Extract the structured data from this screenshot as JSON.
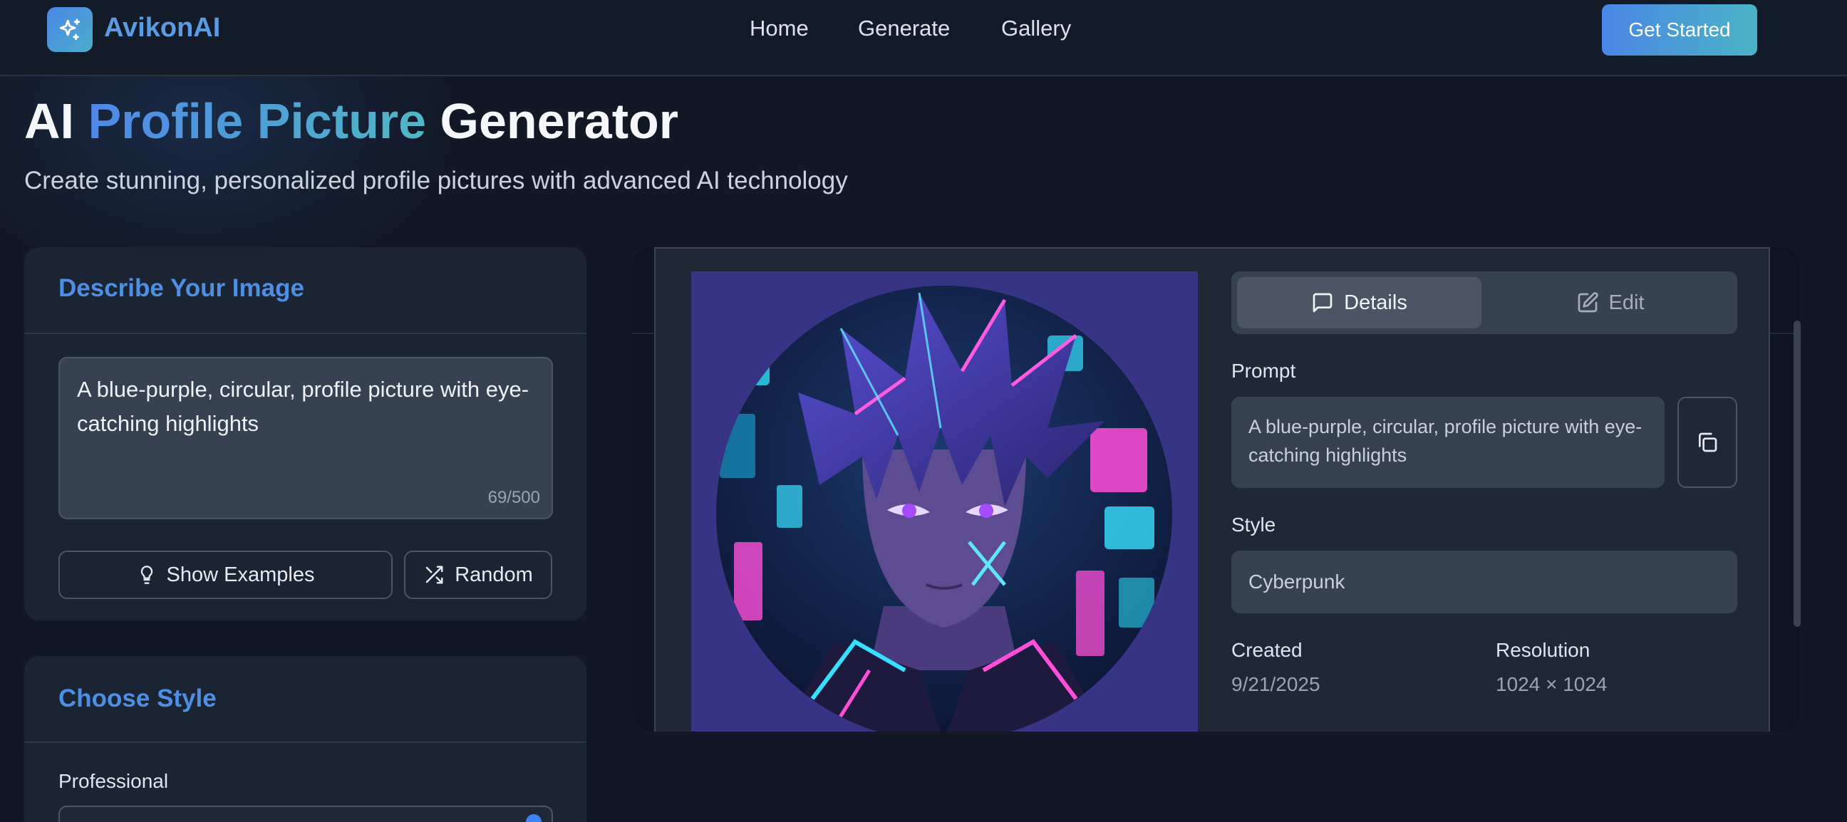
{
  "header": {
    "brand": "AvikonAI",
    "nav": [
      "Home",
      "Generate",
      "Gallery"
    ],
    "cta_label": "Get Started",
    "logo_icon": "sparkles-icon"
  },
  "hero": {
    "title_prefix": "AI",
    "title_highlight": "Profile Picture",
    "title_suffix": "Generator",
    "subtitle": "Create stunning, personalized profile pictures with advanced AI technology"
  },
  "describe": {
    "title": "Describe Your Image",
    "prompt_value": "A blue-purple, circular, profile picture with eye-catching highlights",
    "counter": "69/500",
    "examples_label": "Show Examples",
    "examples_icon": "lightbulb-icon",
    "random_label": "Random",
    "random_icon": "shuffle-icon"
  },
  "style_panel": {
    "title": "Choose Style",
    "option_label": "Professional"
  },
  "preview": {
    "tabs": [
      {
        "label": "Details",
        "icon": "message-square-icon",
        "active": true
      },
      {
        "label": "Edit",
        "icon": "edit-icon",
        "active": false
      }
    ],
    "prompt_label": "Prompt",
    "prompt_text": "A blue-purple, circular, profile picture with eye-catching highlights",
    "copy_icon": "copy-icon",
    "style_label": "Style",
    "style_value": "Cyberpunk",
    "created_label": "Created",
    "created_value": "9/21/2025",
    "resolution_label": "Resolution",
    "resolution_value": "1024 × 1024"
  },
  "colors": {
    "background": "#121826",
    "brand_blue": "#4e8fe4",
    "brand_teal": "#4ab3c5",
    "panel": "#1b2433",
    "art_background": "#373485"
  }
}
